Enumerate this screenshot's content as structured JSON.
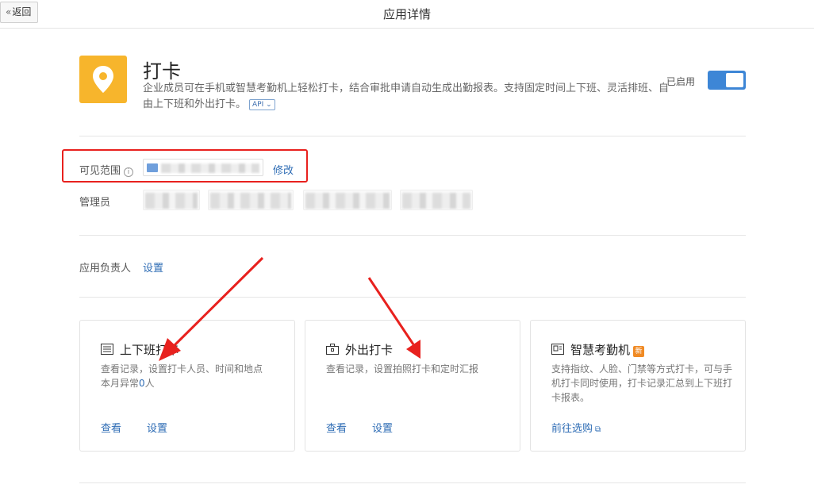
{
  "header": {
    "back_label": "返回",
    "back_chevron": "«",
    "title": "应用详情"
  },
  "app": {
    "name": "打卡",
    "description": "企业成员可在手机或智慧考勤机上轻松打卡，结合审批申请自动生成出勤报表。支持固定时间上下班、灵活排班、自由上下班和外出打卡。",
    "api_tag": "API",
    "status_label": "已启用",
    "enabled": true,
    "icon": "location-pin-icon",
    "icon_color": "#f7b52c"
  },
  "visibility": {
    "label": "可见范围",
    "edit_label": "修改"
  },
  "admins": {
    "label": "管理员"
  },
  "owner": {
    "label": "应用负责人",
    "set_label": "设置"
  },
  "cards": [
    {
      "title": "上下班打卡",
      "icon": "list-icon",
      "desc_line1": "查看记录，设置打卡人员、时间和地点",
      "desc_line2_prefix": "本月异常",
      "desc_line2_count": "0",
      "desc_line2_suffix": "人",
      "view_label": "查看",
      "settings_label": "设置"
    },
    {
      "title": "外出打卡",
      "icon": "briefcase-icon",
      "desc_line1": "查看记录，设置拍照打卡和定时汇报",
      "view_label": "查看",
      "settings_label": "设置"
    },
    {
      "title": "智慧考勤机",
      "icon": "attendance-machine-icon",
      "badge": "新",
      "desc_line1": "支持指纹、人脸、门禁等方式打卡，可与手机打卡同时使用，打卡记录汇总到上下班打卡报表。",
      "link_label": "前往选购"
    }
  ],
  "colors": {
    "accent": "#3d86d6",
    "link": "#2f6db5",
    "annotation_red": "#e8211e",
    "badge_orange": "#f08a24"
  }
}
